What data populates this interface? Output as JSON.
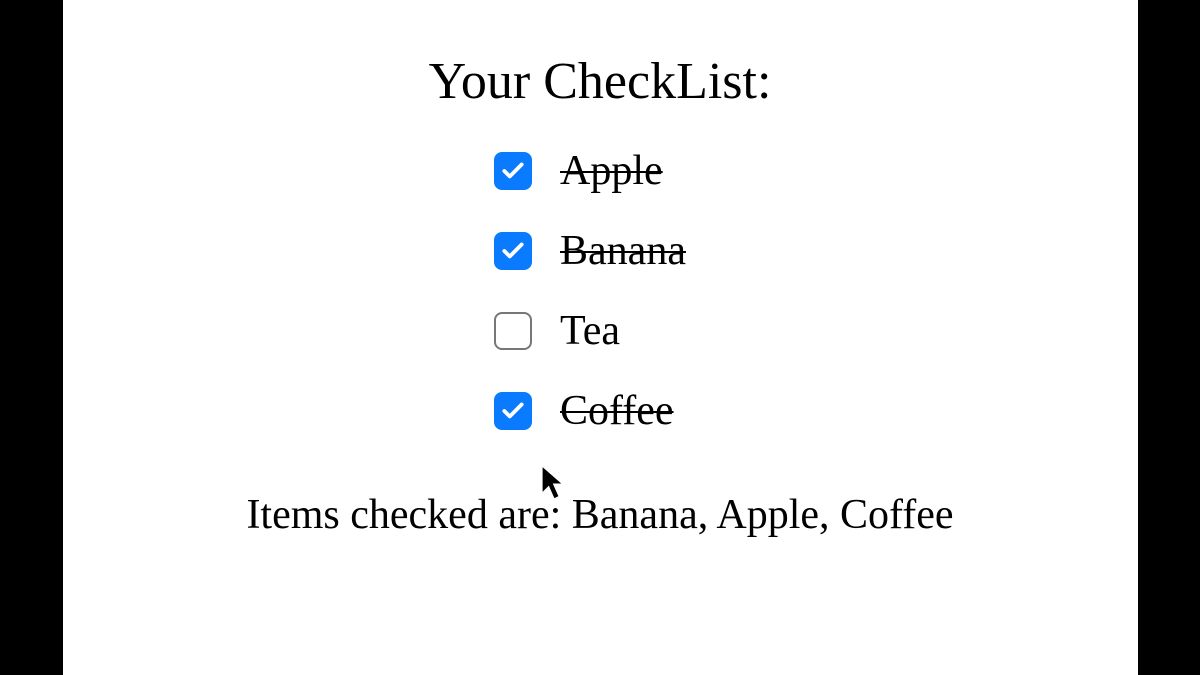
{
  "heading": "Your CheckList:",
  "items": [
    {
      "label": "Apple",
      "checked": true
    },
    {
      "label": "Banana",
      "checked": true
    },
    {
      "label": "Tea",
      "checked": false
    },
    {
      "label": "Coffee",
      "checked": true
    }
  ],
  "summary_prefix": "Items checked are: ",
  "summary_values": "Banana, Apple, Coffee",
  "colors": {
    "checkbox_checked": "#0a7aff"
  }
}
